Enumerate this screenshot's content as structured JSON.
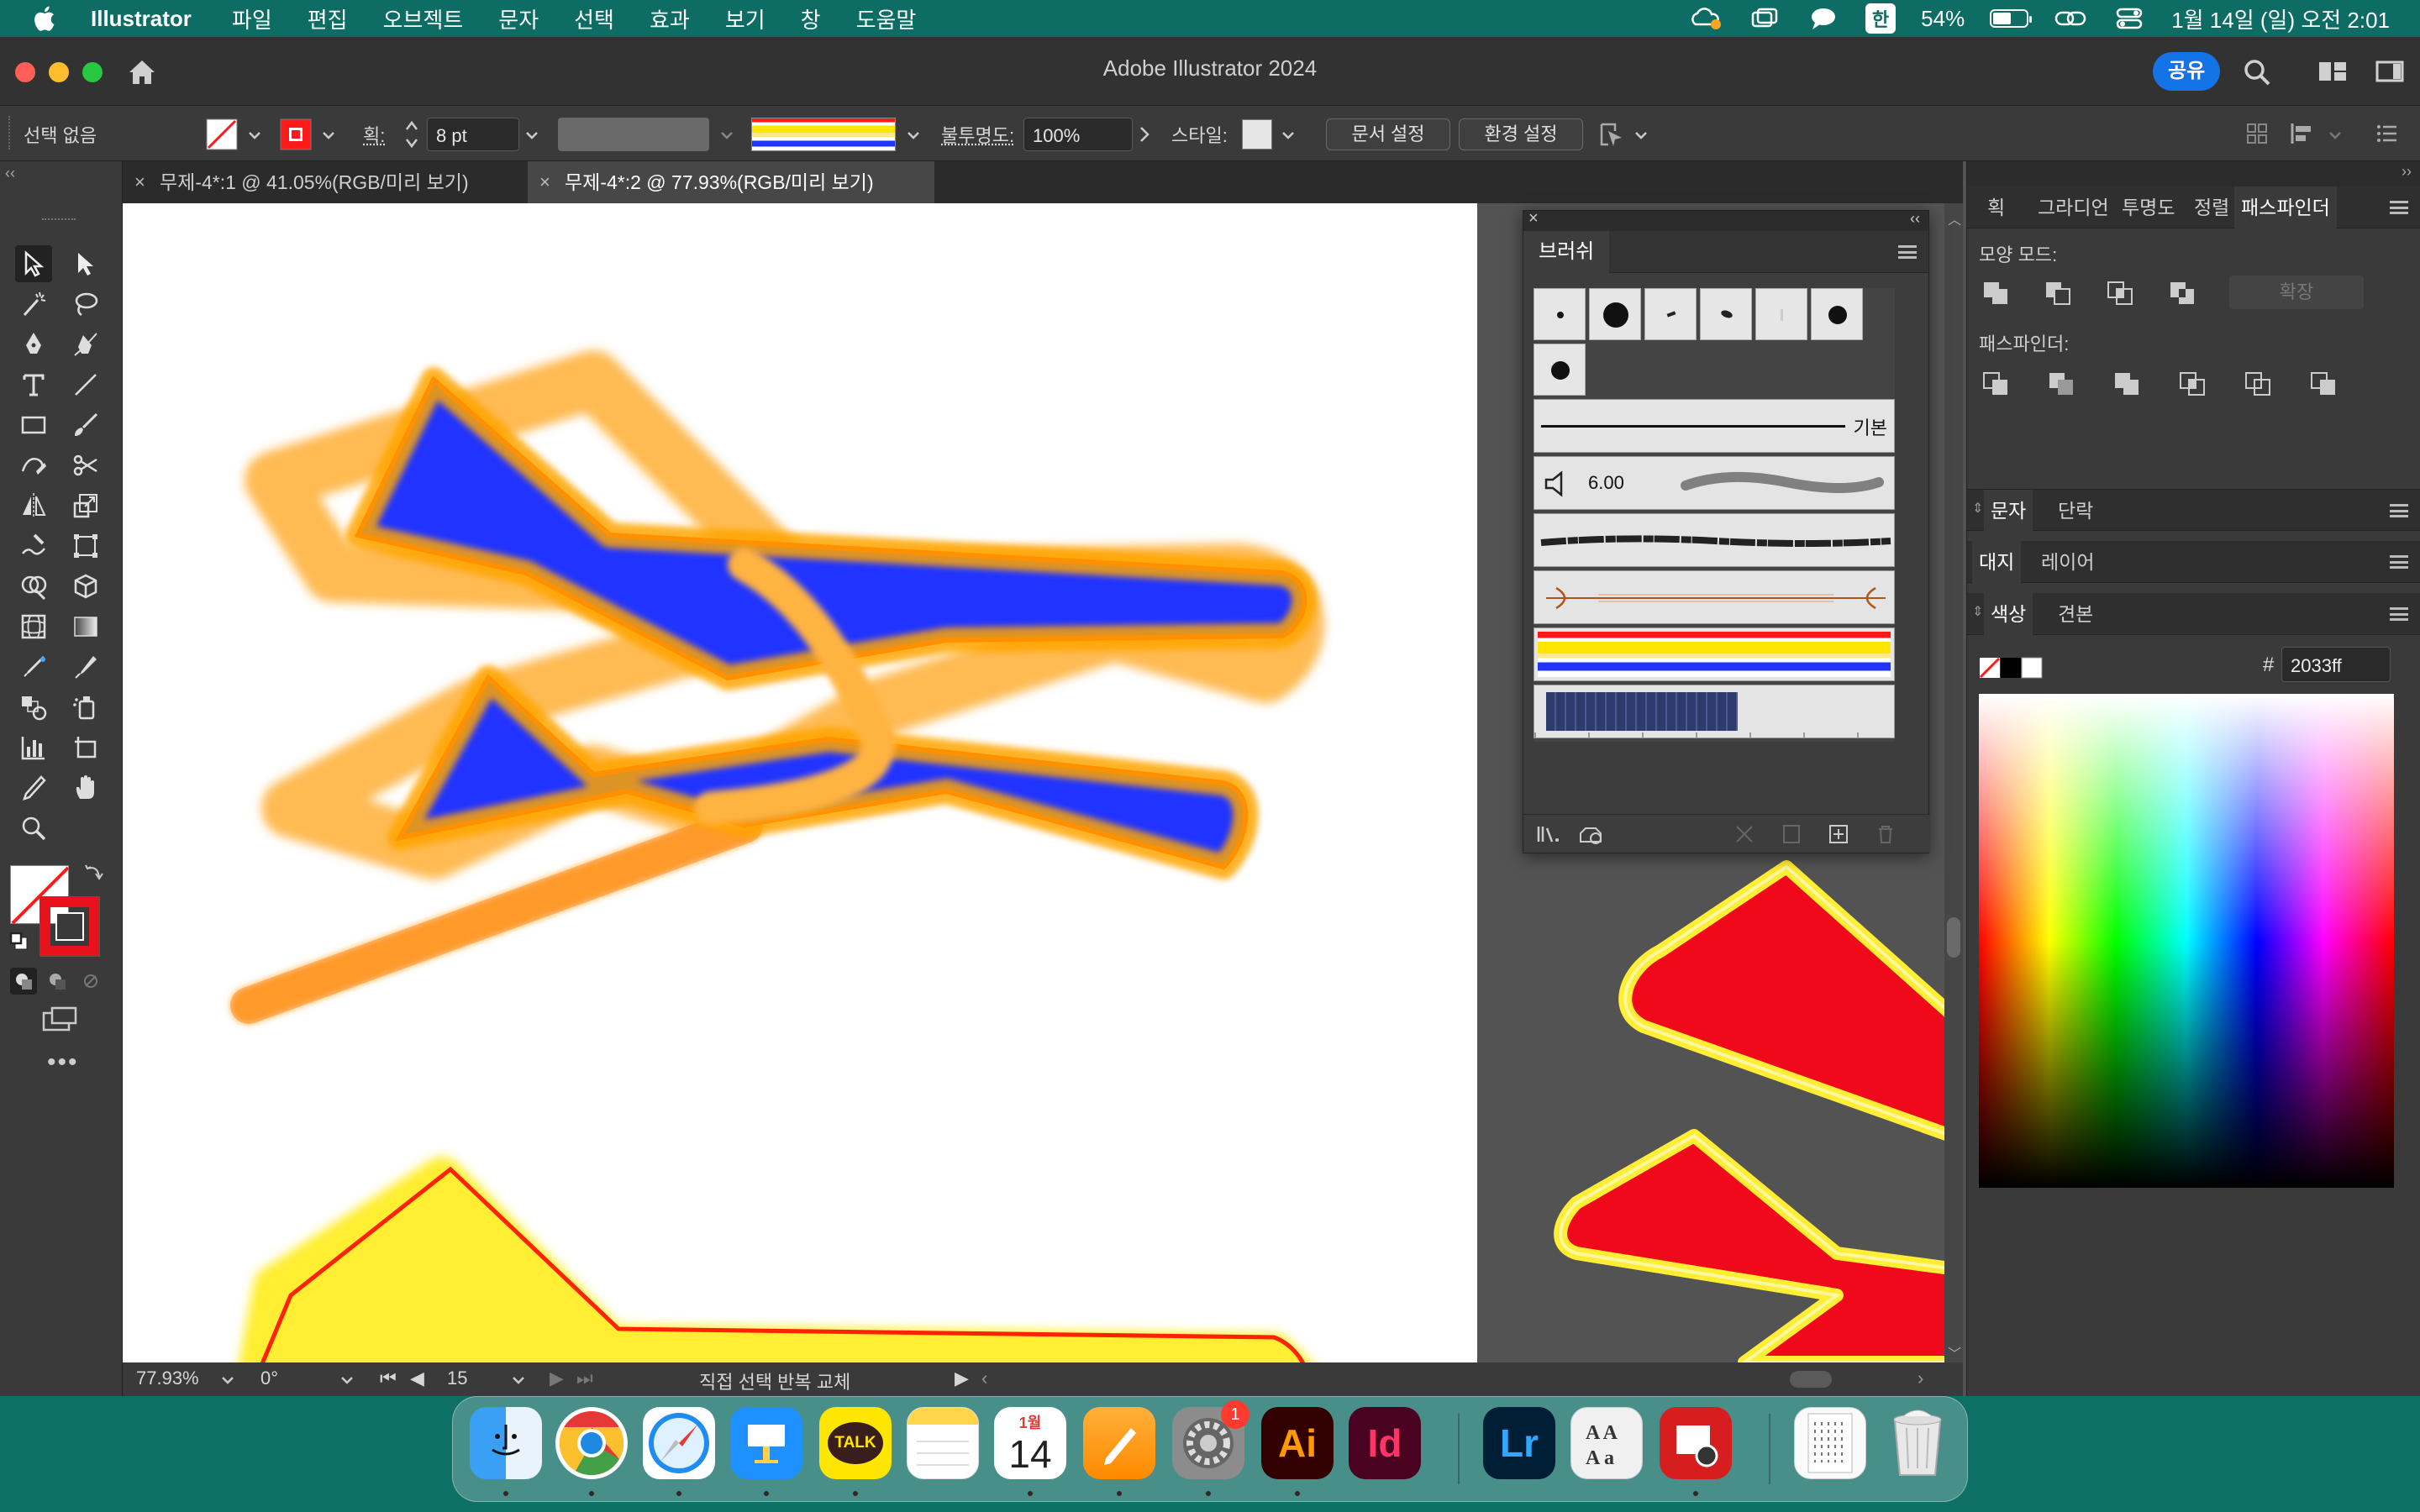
{
  "menubar": {
    "app_name": "Illustrator",
    "menus": [
      "파일",
      "편집",
      "오브젝트",
      "문자",
      "선택",
      "효과",
      "보기",
      "창",
      "도움말"
    ],
    "input_method": "한",
    "battery_percent": "54%",
    "battery_level": 0.54,
    "datetime": "1월 14일 (일) 오전 2:01"
  },
  "titlebar": {
    "title": "Adobe Illustrator 2024",
    "share_label": "공유"
  },
  "controlbar": {
    "selection_label": "선택 없음",
    "stroke_label": "획:",
    "stroke_value": "8 pt",
    "opacity_label": "불투명도:",
    "opacity_value": "100%",
    "style_label": "스타일:",
    "doc_setup_label": "문서 설정",
    "preferences_label": "환경 설정"
  },
  "tabs": [
    {
      "label": "무제-4*:1 @ 41.05%(RGB/미리 보기)",
      "active": false
    },
    {
      "label": "무제-4*:2 @ 77.93%(RGB/미리 보기)",
      "active": true
    }
  ],
  "brush_panel": {
    "title": "브러쉬",
    "basic_label": "기본",
    "size_value": "6.00"
  },
  "right_dock": {
    "top_tabs": [
      "획",
      "그라디언",
      "투명도",
      "정렬",
      "패스파인더"
    ],
    "shape_modes_label": "모양 모드:",
    "expand_label": "확장",
    "pathfinder_label": "패스파인더:",
    "type_tabs": [
      "문자",
      "단락"
    ],
    "layer_tabs": [
      "대지",
      "레이어"
    ],
    "color_tabs": [
      "색상",
      "견본"
    ],
    "hex_symbol": "#",
    "hex_value": "2033ff"
  },
  "statusbar": {
    "zoom": "77.93%",
    "rotation": "0°",
    "artboard_number": "15",
    "status_text": "직접 선택 반복 교체"
  },
  "dock": {
    "apps": [
      "Finder",
      "Chrome",
      "Safari",
      "Keynote",
      "KakaoTalk",
      "Notes",
      "Calendar",
      "Pages",
      "System Settings",
      "Illustrator",
      "InDesign",
      "Lightroom",
      "Font Book",
      "Photo Booth",
      "Document",
      "Trash"
    ],
    "calendar_month": "1월",
    "calendar_day": "14",
    "settings_badge": "1",
    "kakao_label": "TALK",
    "ai_label": "Ai",
    "id_label": "Id",
    "lr_label": "Lr"
  },
  "colors": {
    "fill_blue": "#2033ff",
    "glow_orange": "#ff8a00",
    "outline_red": "#ff2200",
    "yellow": "#ffee33",
    "red_shape": "#f0091a",
    "menubar_bg": "#0d6c63"
  }
}
